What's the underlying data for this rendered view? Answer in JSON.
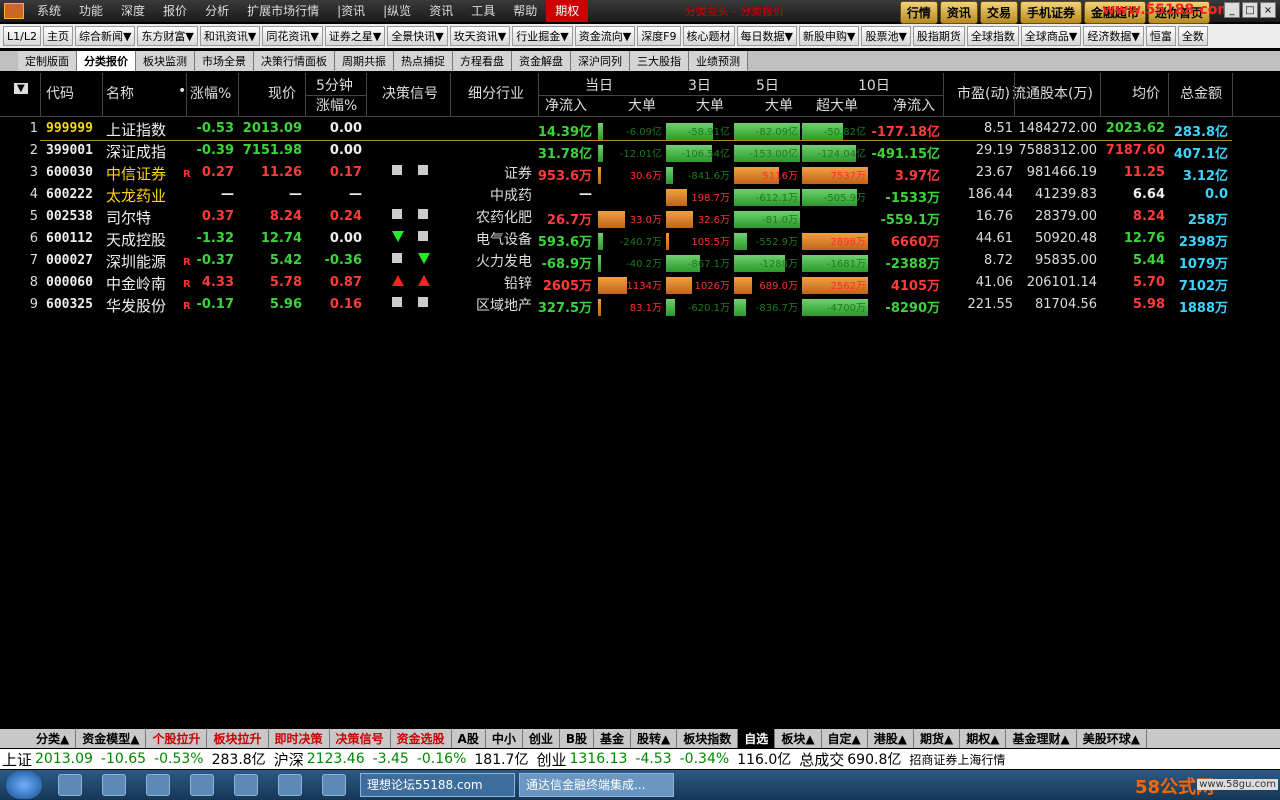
{
  "menubar": {
    "items": [
      "系统",
      "功能",
      "深度",
      "报价",
      "分析",
      "扩展市场行情",
      "|资讯",
      "|纵览",
      "资讯",
      "工具",
      "帮助",
      "期权"
    ],
    "active_index": 11,
    "title": "分类龙头 - 分类报价",
    "right_buttons": [
      "行情",
      "资讯",
      "交易",
      "手机证券",
      "金融超市",
      "迷你首页"
    ],
    "watermark": "www.55188.com"
  },
  "toolbar": {
    "items": [
      "L1/L2",
      "主页",
      "综合新闻▼",
      "东方财富▼",
      "和讯资讯▼",
      "同花资讯▼",
      "证券之星▼",
      "全景快讯▼",
      "玫天资讯▼",
      "行业掘金▼",
      "资金流向▼",
      "深度F9",
      "核心题材",
      "每日数据▼",
      "新股申购▼",
      "股票池▼",
      "股指期货",
      "全球指数",
      "全球商品▼",
      "经济数据▼",
      "恒富",
      "全数"
    ]
  },
  "tabs": {
    "items": [
      "定制版面",
      "分类报价",
      "板块监测",
      "市场全景",
      "决策行情面板",
      "周期共振",
      "热点捕捉",
      "方程看盘",
      "资金解盘",
      "深沪同列",
      "三大股指",
      "业绩预测"
    ],
    "active_index": 1
  },
  "header": {
    "dropdown": "▼",
    "code": "代码",
    "name": "名称",
    "dot": "•",
    "chg": "涨幅%",
    "price": "现价",
    "m5_top": "5分钟",
    "m5_bottom": "涨幅%",
    "signal": "决策信号",
    "industry": "细分行业",
    "today": "当日",
    "d3": "3日",
    "d5": "5日",
    "d10": "10日",
    "net": "净流入",
    "big": "大单",
    "super": "超大单",
    "net10": "净流入",
    "pe": "市盈(动)",
    "shares": "流通股本(万)",
    "avg": "均价",
    "amount": "总金额"
  },
  "rows": [
    {
      "idx": "1",
      "code": "999999",
      "name": "上证指数",
      "r": "",
      "chg": "-0.53",
      "price": "2013.09",
      "m5": "0.00",
      "sig1": "",
      "sig2": "",
      "industry": "",
      "net": "14.39亿",
      "today_big": "-6.09亿",
      "today_big_v": -6.09,
      "d3_big": "-58.91亿",
      "d3_big_v": -58.91,
      "d5_big": "-82.09亿",
      "d5_big_v": -82.09,
      "d10_super": "-50.82亿",
      "d10_super_v": -50.82,
      "net10": "-177.18亿",
      "pe": "8.51",
      "shares": "1484272.00",
      "avg": "2023.62",
      "amount": "283.8亿",
      "chg_color": "green",
      "price_color": "green",
      "m5_color": "white",
      "net_color": "green",
      "net10_color": "red",
      "avg_color": "green",
      "name_color": "white",
      "code_color": "yellow"
    },
    {
      "idx": "2",
      "code": "399001",
      "name": "深证成指",
      "r": "",
      "chg": "-0.39",
      "price": "7151.98",
      "m5": "0.00",
      "sig1": "",
      "sig2": "",
      "industry": "",
      "net": "31.78亿",
      "today_big": "-12.01亿",
      "today_big_v": -12.01,
      "d3_big": "-106.54亿",
      "d3_big_v": -106.54,
      "d5_big": "-153.00亿",
      "d5_big_v": -153.0,
      "d10_super": "-124.04亿",
      "d10_super_v": -124.04,
      "net10": "-491.15亿",
      "pe": "29.19",
      "shares": "7588312.00",
      "avg": "7187.60",
      "amount": "407.1亿",
      "chg_color": "green",
      "price_color": "green",
      "m5_color": "white",
      "net_color": "green",
      "net10_color": "green",
      "avg_color": "red",
      "name_color": "white",
      "code_color": "white"
    },
    {
      "idx": "3",
      "code": "600030",
      "name": "中信证券",
      "r": "R",
      "chg": "0.27",
      "price": "11.26",
      "m5": "0.17",
      "sig1": "sq",
      "sig2": "sq",
      "industry": "证券",
      "net": "953.6万",
      "today_big": "30.6万",
      "today_big_v": 30.6,
      "d3_big": "-841.6万",
      "d3_big_v": -841.6,
      "d5_big": "5116万",
      "d5_big_v": 5116,
      "d10_super": "7537万",
      "d10_super_v": 7537,
      "net10": "3.97亿",
      "pe": "23.67",
      "shares": "981466.19",
      "avg": "11.25",
      "amount": "3.12亿",
      "chg_color": "red",
      "price_color": "red",
      "m5_color": "red",
      "net_color": "red",
      "net10_color": "red",
      "avg_color": "red",
      "name_color": "yellow",
      "code_color": "white"
    },
    {
      "idx": "4",
      "code": "600222",
      "name": "太龙药业",
      "r": "",
      "chg": "—",
      "price": "—",
      "m5": "—",
      "sig1": "",
      "sig2": "",
      "industry": "中成药",
      "net": "—",
      "today_big": "",
      "today_big_v": 0,
      "d3_big": "198.7万",
      "d3_big_v": 198.7,
      "d5_big": "-612.1万",
      "d5_big_v": -612.1,
      "d10_super": "-505.9万",
      "d10_super_v": -505.9,
      "net10": "-1533万",
      "pe": "186.44",
      "shares": "41239.83",
      "avg": "6.64",
      "amount": "0.0",
      "chg_color": "white",
      "price_color": "white",
      "m5_color": "white",
      "net_color": "white",
      "net10_color": "green",
      "avg_color": "white",
      "name_color": "yellow",
      "code_color": "white"
    },
    {
      "idx": "5",
      "code": "002538",
      "name": "司尔特",
      "r": "",
      "chg": "0.37",
      "price": "8.24",
      "m5": "0.24",
      "sig1": "sq",
      "sig2": "sq",
      "industry": "农药化肥",
      "net": "26.7万",
      "today_big": "33.0万",
      "today_big_v": 33.0,
      "d3_big": "32.6万",
      "d3_big_v": 32.6,
      "d5_big": "-81.0万",
      "d5_big_v": -81.0,
      "d10_super": "",
      "d10_super_v": 0,
      "net10": "-559.1万",
      "pe": "16.76",
      "shares": "28379.00",
      "avg": "8.24",
      "amount": "258万",
      "chg_color": "red",
      "price_color": "red",
      "m5_color": "red",
      "net_color": "red",
      "net10_color": "green",
      "avg_color": "red",
      "name_color": "white",
      "code_color": "white"
    },
    {
      "idx": "6",
      "code": "600112",
      "name": "天成控股",
      "r": "",
      "chg": "-1.32",
      "price": "12.74",
      "m5": "0.00",
      "sig1": "dn",
      "sig2": "sq",
      "industry": "电气设备",
      "net": "593.6万",
      "today_big": "-240.7万",
      "today_big_v": -240.7,
      "d3_big": "105.5万",
      "d3_big_v": 105.5,
      "d5_big": "-552.9万",
      "d5_big_v": -552.9,
      "d10_super": "2898万",
      "d10_super_v": 2898,
      "net10": "6660万",
      "pe": "44.61",
      "shares": "50920.48",
      "avg": "12.76",
      "amount": "2398万",
      "chg_color": "green",
      "price_color": "green",
      "m5_color": "white",
      "net_color": "green",
      "net10_color": "red",
      "avg_color": "green",
      "name_color": "white",
      "code_color": "white"
    },
    {
      "idx": "7",
      "code": "000027",
      "name": "深圳能源",
      "r": "R",
      "chg": "-0.37",
      "price": "5.42",
      "m5": "-0.36",
      "sig1": "sq",
      "sig2": "dn",
      "industry": "火力发电",
      "net": "-68.9万",
      "today_big": "-40.2万",
      "today_big_v": -40.2,
      "d3_big": "-867.1万",
      "d3_big_v": -867.1,
      "d5_big": "-1288万",
      "d5_big_v": -1288,
      "d10_super": "-1681万",
      "d10_super_v": -1681,
      "net10": "-2388万",
      "pe": "8.72",
      "shares": "95835.00",
      "avg": "5.44",
      "amount": "1079万",
      "chg_color": "green",
      "price_color": "green",
      "m5_color": "green",
      "net_color": "green",
      "net10_color": "green",
      "avg_color": "green",
      "name_color": "white",
      "code_color": "white"
    },
    {
      "idx": "8",
      "code": "000060",
      "name": "中金岭南",
      "r": "R",
      "chg": "4.33",
      "price": "5.78",
      "m5": "0.87",
      "sig1": "up",
      "sig2": "up",
      "industry": "铅锌",
      "net": "2605万",
      "today_big": "1134万",
      "today_big_v": 1134,
      "d3_big": "1026万",
      "d3_big_v": 1026,
      "d5_big": "689.0万",
      "d5_big_v": 689.0,
      "d10_super": "2562万",
      "d10_super_v": 2562,
      "net10": "4105万",
      "pe": "41.06",
      "shares": "206101.14",
      "avg": "5.70",
      "amount": "7102万",
      "chg_color": "red",
      "price_color": "red",
      "m5_color": "red",
      "net_color": "red",
      "net10_color": "red",
      "avg_color": "red",
      "name_color": "white",
      "code_color": "white"
    },
    {
      "idx": "9",
      "code": "600325",
      "name": "华发股份",
      "r": "R",
      "chg": "-0.17",
      "price": "5.96",
      "m5": "0.16",
      "sig1": "sq",
      "sig2": "sq",
      "industry": "区域地产",
      "net": "327.5万",
      "today_big": "83.1万",
      "today_big_v": 83.1,
      "d3_big": "-620.1万",
      "d3_big_v": -620.1,
      "d5_big": "-836.7万",
      "d5_big_v": -836.7,
      "d10_super": "-4700万",
      "d10_super_v": -4700,
      "net10": "-8290万",
      "pe": "221.55",
      "shares": "81704.56",
      "avg": "5.98",
      "amount": "1888万",
      "chg_color": "green",
      "price_color": "green",
      "m5_color": "red",
      "net_color": "green",
      "net10_color": "green",
      "avg_color": "red",
      "name_color": "white",
      "code_color": "white"
    }
  ],
  "bottom_tabs": {
    "items": [
      "分类▲",
      "资金模型▲",
      "个股拉升",
      "板块拉升",
      "即时决策",
      "决策信号",
      "资金选股",
      "A股",
      "中小",
      "创业",
      "B股",
      "基金",
      "股转▲",
      "板块指数",
      "自选",
      "板块▲",
      "自定▲",
      "港股▲",
      "期货▲",
      "期权▲",
      "基金理财▲",
      "美股环球▲"
    ],
    "red_indices": [
      2,
      3,
      4,
      5,
      6
    ],
    "active_index": 14
  },
  "ticker": {
    "sh_label": "上证",
    "sh_index": "2013.09",
    "sh_change": "-10.65",
    "sh_pct": "-0.53%",
    "sh_amount": "283.8亿",
    "hs_label": "沪深",
    "hs_index": "2123.46",
    "hs_change": "-3.45",
    "hs_pct": "-0.16%",
    "hs_amount": "181.7亿",
    "cy_label": "创业",
    "cy_index": "1316.13",
    "cy_change": "-4.53",
    "cy_pct": "-0.34%",
    "cy_amount": "116.0亿",
    "total_label": "总成交",
    "total_amount": "690.8亿",
    "broker": "招商证券上海行情"
  },
  "taskbar": {
    "tasks": [
      "理想论坛55188.com",
      "通达信金融终端集成..."
    ],
    "active_task": 1,
    "brand": "58公式网",
    "brand_url": "www.58gu.com"
  },
  "colors": {
    "red": "#ff3b3b",
    "green": "#3bd43b",
    "orange_bar": "#e88a2a",
    "green_bar": "#3cb03c",
    "cyan": "#3ad6ff",
    "yellow": "#ffd700"
  }
}
